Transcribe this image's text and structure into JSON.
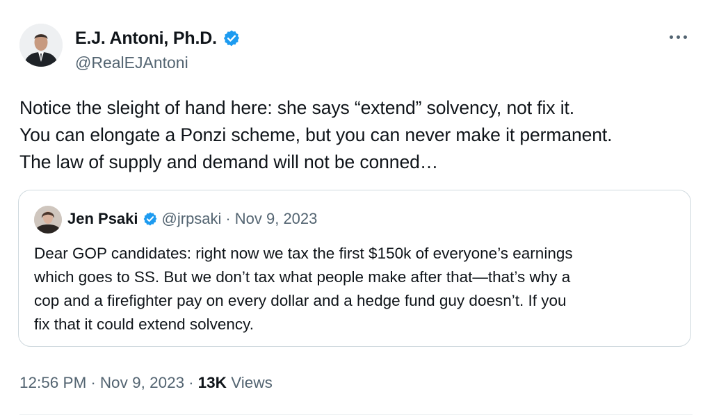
{
  "author": {
    "display_name": "E.J. Antoni, Ph.D.",
    "handle": "@RealEJAntoni",
    "verified": true,
    "avatar_icon": "profile-photo"
  },
  "menu": {
    "icon": "more-options-icon"
  },
  "post": {
    "text": "Notice the sleight of hand here: she says “extend” solvency, not fix it.\nYou can elongate a Ponzi scheme, but you can never make it permanent.\nThe law of supply and demand will not be conned…"
  },
  "quoted_post": {
    "display_name": "Jen Psaki",
    "handle": "@jrpsaki",
    "separator": "·",
    "date": "Nov 9, 2023",
    "verified": true,
    "text": "Dear GOP candidates:  right now we tax the first $150k of everyone’s earnings\nwhich goes to SS. But we don’t tax what people make after that—that’s why a\ncop and a firefighter pay on every dollar and a hedge fund guy doesn’t.  If you\nfix that it could extend solvency."
  },
  "meta": {
    "time": "12:56 PM",
    "separator": "·",
    "date": "Nov 9, 2023",
    "separator2": "·",
    "views_count": "13K",
    "views_label": "Views"
  },
  "colors": {
    "verified_blue": "#1d9bf0",
    "secondary_text": "#536471",
    "border": "#cfd9de"
  }
}
